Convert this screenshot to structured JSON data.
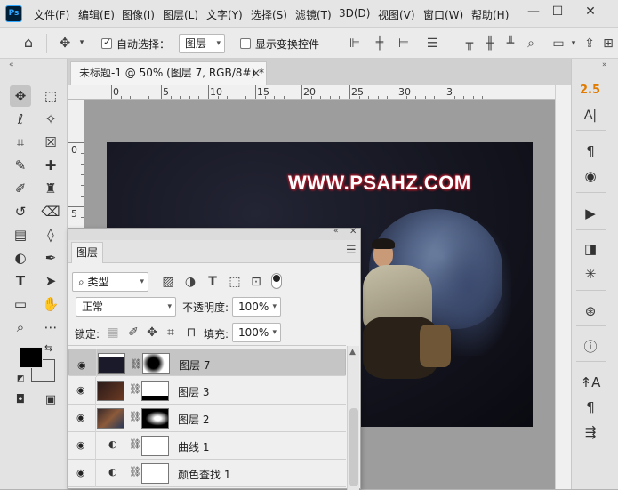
{
  "app": {
    "logo": "Ps"
  },
  "menu": [
    "文件(F)",
    "编辑(E)",
    "图像(I)",
    "图层(L)",
    "文字(Y)",
    "选择(S)",
    "滤镜(T)",
    "3D(D)",
    "视图(V)",
    "窗口(W)",
    "帮助(H)"
  ],
  "options": {
    "auto_select_label": "自动选择：",
    "auto_select_value": "图层",
    "show_transform_label": "显示变换控件"
  },
  "document": {
    "tab_title": "未标题-1 @ 50% (图层 7, RGB/8#) *",
    "close": "×",
    "watermark": "WWW.PSAHZ.COM"
  },
  "ruler": {
    "h": [
      "0",
      "5",
      "10",
      "15",
      "20",
      "25",
      "30",
      "3"
    ],
    "v": [
      "0",
      "5"
    ]
  },
  "right_panel": {
    "value": "2.5"
  },
  "layers_panel": {
    "tab": "图层",
    "filter_label": "类型",
    "blend_mode": "正常",
    "opacity_label": "不透明度:",
    "opacity_value": "100%",
    "lock_label": "锁定:",
    "fill_label": "填充:",
    "fill_value": "100%",
    "layers": [
      {
        "name": "图层 7",
        "kind": "smart"
      },
      {
        "name": "图层 3",
        "kind": "smart"
      },
      {
        "name": "图层 2",
        "kind": "smart"
      },
      {
        "name": "曲线 1",
        "kind": "adjustment"
      },
      {
        "name": "颜色查找 1",
        "kind": "adjustment"
      }
    ]
  },
  "colors": {
    "foreground": "#000000",
    "background": "#ffffff",
    "watermark_glow": "#b01a2a"
  }
}
